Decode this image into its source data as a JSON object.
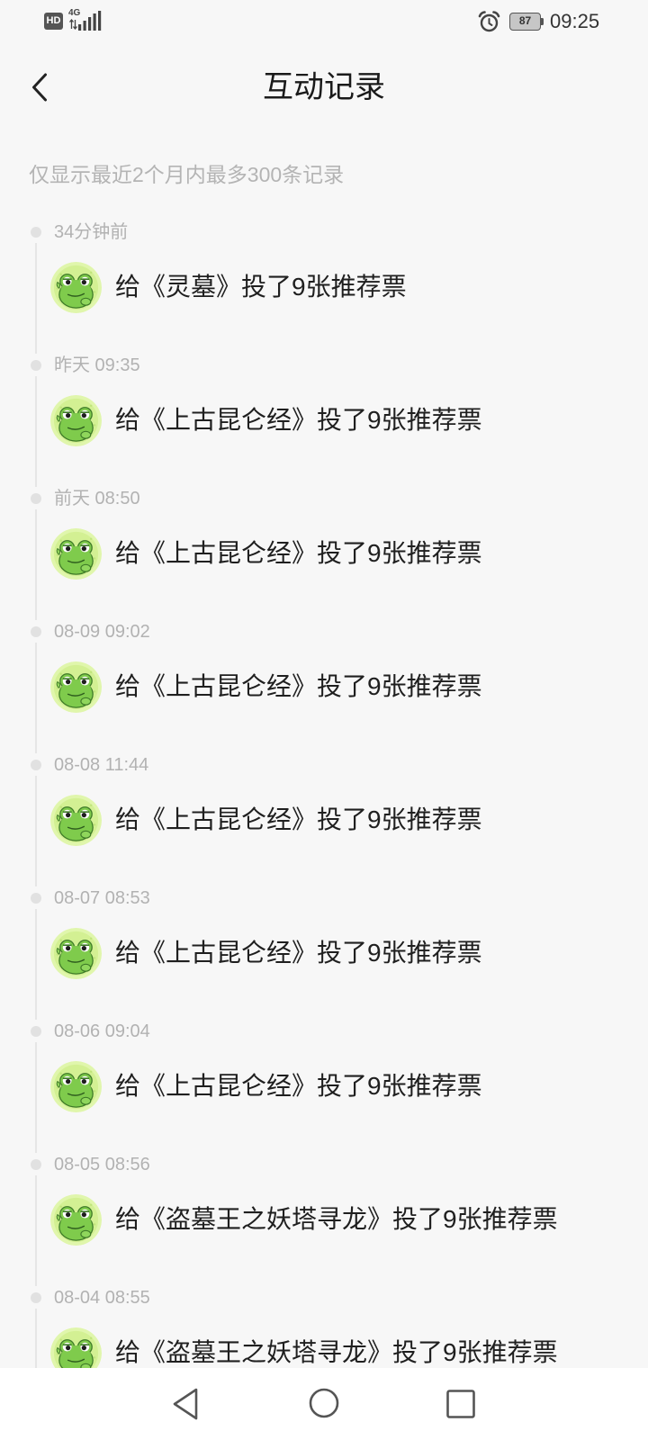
{
  "status_bar": {
    "hd_badge": "HD",
    "network_type": "4G",
    "battery_level": "87",
    "time": "09:25",
    "alarm_icon": "alarm-clock-icon",
    "signal_icon": "signal-bars-icon"
  },
  "header": {
    "back_icon": "chevron-left-icon",
    "title": "互动记录"
  },
  "notice": "仅显示最近2个月内最多300条记录",
  "records": [
    {
      "time": "34分钟前",
      "text": "给《灵墓》投了9张推荐票",
      "avatar_icon": "frog-icon"
    },
    {
      "time": "昨天 09:35",
      "text": "给《上古昆仑经》投了9张推荐票",
      "avatar_icon": "frog-icon"
    },
    {
      "time": "前天 08:50",
      "text": "给《上古昆仑经》投了9张推荐票",
      "avatar_icon": "frog-icon"
    },
    {
      "time": "08-09 09:02",
      "text": "给《上古昆仑经》投了9张推荐票",
      "avatar_icon": "frog-icon"
    },
    {
      "time": "08-08 11:44",
      "text": "给《上古昆仑经》投了9张推荐票",
      "avatar_icon": "frog-icon"
    },
    {
      "time": "08-07 08:53",
      "text": "给《上古昆仑经》投了9张推荐票",
      "avatar_icon": "frog-icon"
    },
    {
      "time": "08-06 09:04",
      "text": "给《上古昆仑经》投了9张推荐票",
      "avatar_icon": "frog-icon"
    },
    {
      "time": "08-05 08:56",
      "text": "给《盗墓王之妖塔寻龙》投了9张推荐票",
      "avatar_icon": "frog-icon"
    },
    {
      "time": "08-04 08:55",
      "text": "给《盗墓王之妖塔寻龙》投了9张推荐票",
      "avatar_icon": "frog-icon"
    }
  ],
  "nav_bar": {
    "back_icon": "triangle-back-icon",
    "home_icon": "circle-home-icon",
    "recents_icon": "square-recents-icon"
  },
  "colors": {
    "background": "#f7f7f7",
    "nav_background": "#ffffff",
    "avatar_green": "#7fcb4c",
    "avatar_background": "#d3f093",
    "secondary_text": "#b2b2b2"
  }
}
